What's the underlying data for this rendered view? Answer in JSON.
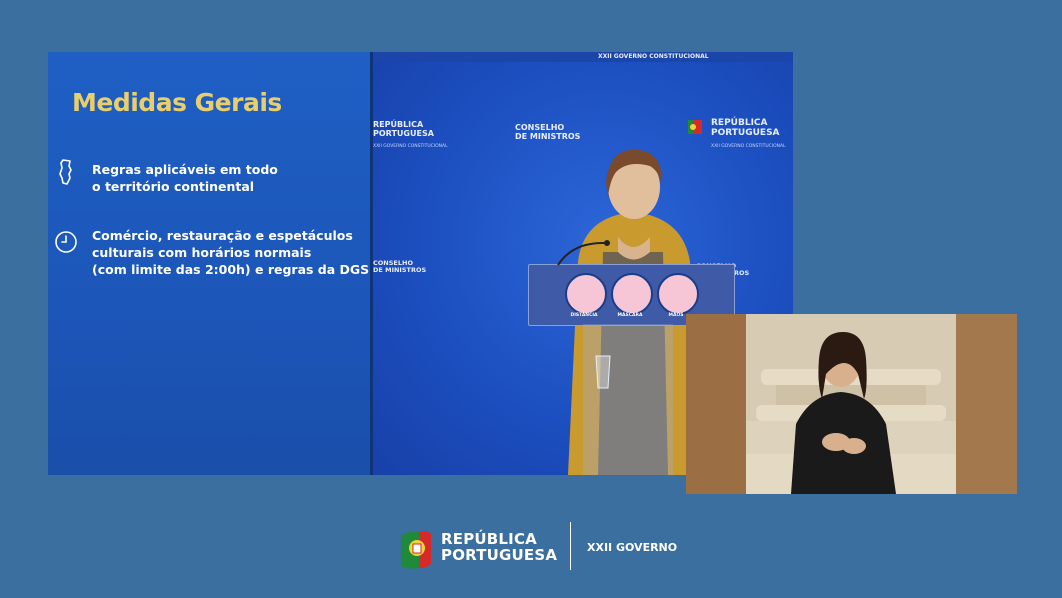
{
  "slide": {
    "title": "Medidas Gerais",
    "items": [
      {
        "icon": "portugal-map-icon",
        "line1": "Regras aplicáveis em todo",
        "line2": "o território continental"
      },
      {
        "icon": "clock-icon",
        "line1": "Comércio, restauração e espetáculos",
        "line2": "culturais com horários normais",
        "line3": "(com limite das 2:00h) e regras da DGS"
      }
    ]
  },
  "backdrop": {
    "top_label": "XXII GOVERNO CONSTITUCIONAL",
    "republica_line1": "REPÚBLICA",
    "republica_line2": "PORTUGUESA",
    "conselho_line1": "CONSELHO",
    "conselho_line2": "DE MINISTROS",
    "subtitle": "XXII GOVERNO CONSTITUCIONAL",
    "left_partial_line1": "REPÚBLICA",
    "left_partial_line2": "PORTUGUESA",
    "left_partial_sub": "XXII GOVERNO CONSTITUCIONAL",
    "lower_conselho_line1": "CONSELHO",
    "lower_conselho_line2": "DE MINISTROS"
  },
  "lectern": {
    "signs": [
      {
        "icon": "distance-icon",
        "label": "DISTÂNCIA"
      },
      {
        "icon": "mask-icon",
        "label": "MÁSCARA"
      },
      {
        "icon": "hands-icon",
        "label": "MÃOS"
      }
    ]
  },
  "footer": {
    "line1": "REPÚBLICA",
    "line2": "PORTUGUESA",
    "government": "XXII GOVERNO"
  },
  "colors": {
    "page_bg": "#3a6f9f",
    "slide_bg": "#1f5fc4",
    "title_gold": "#e9cf6c",
    "sign_pink": "#f6c6d6",
    "flag_green": "#1f8a3a",
    "flag_red": "#d42a2a"
  }
}
